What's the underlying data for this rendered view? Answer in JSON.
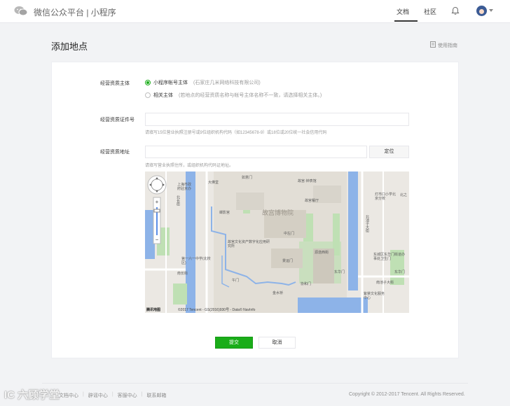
{
  "header": {
    "brand": "微信公众平台 | 小程序",
    "nav": {
      "docs": "文档",
      "community": "社区"
    }
  },
  "page": {
    "title": "添加地点",
    "guide_link": "使用指南"
  },
  "form": {
    "entity": {
      "label": "经营资质主体",
      "option1_label": "小程序帐号主体",
      "option1_note": "(石家庄几米网络科技有限公司)",
      "option2_label": "相关主体",
      "option2_note": "(若地点的经营资质名称与帐号主体名称不一致，请选择相关主体。)"
    },
    "license": {
      "label": "经营资质证件号",
      "value": "",
      "hint": "请填写15位营业执照注册号或9位组织机构代码（如12345678-9）或18位或20位统一社会信用代码"
    },
    "address": {
      "label": "经营资质地址",
      "value": "",
      "locate_button": "定位",
      "hint": "请填写营业执照住所，或组织机构代码证地址。"
    }
  },
  "map": {
    "labels": {
      "l1": "大佛堂",
      "l2": "如意门",
      "l3": "故宫·钟表馆",
      "l4": "故宫餐厅",
      "l5": "故宫博物院",
      "l6": "上海市政府驻京办",
      "l7": "北长街",
      "l8": "南长街",
      "l9": "蝶影宫",
      "l10": "故宫文化资产数字化应用研究所",
      "l11": "中左门",
      "l12": "源逸西街",
      "l13": "景运门",
      "l14": "第一六一中学(北校区)",
      "l15": "协和门",
      "l16": "东华门",
      "l17": "午门",
      "l18": "金水桥",
      "l19": "灯市口小学北京分校",
      "l20": "东城区东华门街道办事处卫生门",
      "l21": "紫禁文化服务中心",
      "l22": "北池子大街",
      "l23": "南池子大街",
      "l24": "东华门",
      "l25": "北之"
    },
    "brand": "腾讯地图",
    "copyright": "©2017 Tencent - GS(2016)930号 - Data© NavInfo"
  },
  "actions": {
    "submit": "提交",
    "cancel": "取消"
  },
  "footer": {
    "links": [
      "文档中心",
      "辟谣中心",
      "客服中心",
      "联系邮箱"
    ],
    "copyright": "Copyright © 2012-2017 Tencent. All Rights Reserved.",
    "watermark": "IC 六顾学堂"
  },
  "colors": {
    "accent": "#1aad19",
    "water": "#8db3e8",
    "green": "#bfe0b4"
  }
}
